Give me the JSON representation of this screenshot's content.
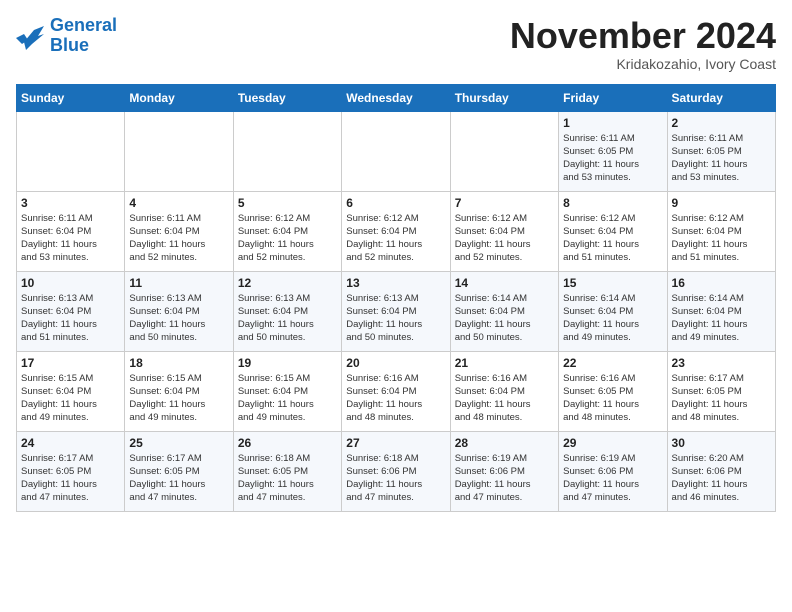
{
  "logo": {
    "line1": "General",
    "line2": "Blue"
  },
  "title": "November 2024",
  "location": "Kridakozahio, Ivory Coast",
  "days_of_week": [
    "Sunday",
    "Monday",
    "Tuesday",
    "Wednesday",
    "Thursday",
    "Friday",
    "Saturday"
  ],
  "weeks": [
    [
      {
        "day": "",
        "detail": ""
      },
      {
        "day": "",
        "detail": ""
      },
      {
        "day": "",
        "detail": ""
      },
      {
        "day": "",
        "detail": ""
      },
      {
        "day": "",
        "detail": ""
      },
      {
        "day": "1",
        "detail": "Sunrise: 6:11 AM\nSunset: 6:05 PM\nDaylight: 11 hours\nand 53 minutes."
      },
      {
        "day": "2",
        "detail": "Sunrise: 6:11 AM\nSunset: 6:05 PM\nDaylight: 11 hours\nand 53 minutes."
      }
    ],
    [
      {
        "day": "3",
        "detail": "Sunrise: 6:11 AM\nSunset: 6:04 PM\nDaylight: 11 hours\nand 53 minutes."
      },
      {
        "day": "4",
        "detail": "Sunrise: 6:11 AM\nSunset: 6:04 PM\nDaylight: 11 hours\nand 52 minutes."
      },
      {
        "day": "5",
        "detail": "Sunrise: 6:12 AM\nSunset: 6:04 PM\nDaylight: 11 hours\nand 52 minutes."
      },
      {
        "day": "6",
        "detail": "Sunrise: 6:12 AM\nSunset: 6:04 PM\nDaylight: 11 hours\nand 52 minutes."
      },
      {
        "day": "7",
        "detail": "Sunrise: 6:12 AM\nSunset: 6:04 PM\nDaylight: 11 hours\nand 52 minutes."
      },
      {
        "day": "8",
        "detail": "Sunrise: 6:12 AM\nSunset: 6:04 PM\nDaylight: 11 hours\nand 51 minutes."
      },
      {
        "day": "9",
        "detail": "Sunrise: 6:12 AM\nSunset: 6:04 PM\nDaylight: 11 hours\nand 51 minutes."
      }
    ],
    [
      {
        "day": "10",
        "detail": "Sunrise: 6:13 AM\nSunset: 6:04 PM\nDaylight: 11 hours\nand 51 minutes."
      },
      {
        "day": "11",
        "detail": "Sunrise: 6:13 AM\nSunset: 6:04 PM\nDaylight: 11 hours\nand 50 minutes."
      },
      {
        "day": "12",
        "detail": "Sunrise: 6:13 AM\nSunset: 6:04 PM\nDaylight: 11 hours\nand 50 minutes."
      },
      {
        "day": "13",
        "detail": "Sunrise: 6:13 AM\nSunset: 6:04 PM\nDaylight: 11 hours\nand 50 minutes."
      },
      {
        "day": "14",
        "detail": "Sunrise: 6:14 AM\nSunset: 6:04 PM\nDaylight: 11 hours\nand 50 minutes."
      },
      {
        "day": "15",
        "detail": "Sunrise: 6:14 AM\nSunset: 6:04 PM\nDaylight: 11 hours\nand 49 minutes."
      },
      {
        "day": "16",
        "detail": "Sunrise: 6:14 AM\nSunset: 6:04 PM\nDaylight: 11 hours\nand 49 minutes."
      }
    ],
    [
      {
        "day": "17",
        "detail": "Sunrise: 6:15 AM\nSunset: 6:04 PM\nDaylight: 11 hours\nand 49 minutes."
      },
      {
        "day": "18",
        "detail": "Sunrise: 6:15 AM\nSunset: 6:04 PM\nDaylight: 11 hours\nand 49 minutes."
      },
      {
        "day": "19",
        "detail": "Sunrise: 6:15 AM\nSunset: 6:04 PM\nDaylight: 11 hours\nand 49 minutes."
      },
      {
        "day": "20",
        "detail": "Sunrise: 6:16 AM\nSunset: 6:04 PM\nDaylight: 11 hours\nand 48 minutes."
      },
      {
        "day": "21",
        "detail": "Sunrise: 6:16 AM\nSunset: 6:04 PM\nDaylight: 11 hours\nand 48 minutes."
      },
      {
        "day": "22",
        "detail": "Sunrise: 6:16 AM\nSunset: 6:05 PM\nDaylight: 11 hours\nand 48 minutes."
      },
      {
        "day": "23",
        "detail": "Sunrise: 6:17 AM\nSunset: 6:05 PM\nDaylight: 11 hours\nand 48 minutes."
      }
    ],
    [
      {
        "day": "24",
        "detail": "Sunrise: 6:17 AM\nSunset: 6:05 PM\nDaylight: 11 hours\nand 47 minutes."
      },
      {
        "day": "25",
        "detail": "Sunrise: 6:17 AM\nSunset: 6:05 PM\nDaylight: 11 hours\nand 47 minutes."
      },
      {
        "day": "26",
        "detail": "Sunrise: 6:18 AM\nSunset: 6:05 PM\nDaylight: 11 hours\nand 47 minutes."
      },
      {
        "day": "27",
        "detail": "Sunrise: 6:18 AM\nSunset: 6:06 PM\nDaylight: 11 hours\nand 47 minutes."
      },
      {
        "day": "28",
        "detail": "Sunrise: 6:19 AM\nSunset: 6:06 PM\nDaylight: 11 hours\nand 47 minutes."
      },
      {
        "day": "29",
        "detail": "Sunrise: 6:19 AM\nSunset: 6:06 PM\nDaylight: 11 hours\nand 47 minutes."
      },
      {
        "day": "30",
        "detail": "Sunrise: 6:20 AM\nSunset: 6:06 PM\nDaylight: 11 hours\nand 46 minutes."
      }
    ]
  ]
}
